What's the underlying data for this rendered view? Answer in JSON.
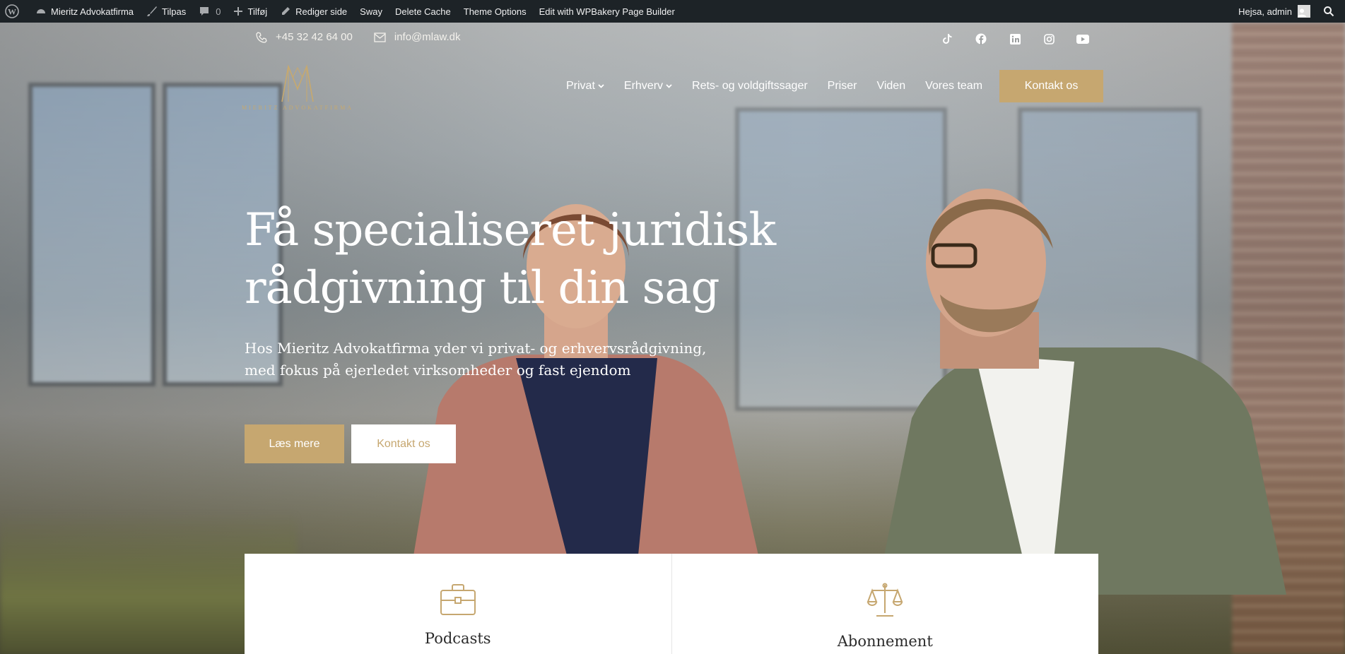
{
  "adminbar": {
    "site_name": "Mieritz Advokatfirma",
    "customize": "Tilpas",
    "comments_count": "0",
    "new": "Tilføj",
    "edit_page": "Rediger side",
    "sway": "Sway",
    "delete_cache": "Delete Cache",
    "theme_options": "Theme Options",
    "wpbakery": "Edit with WPBakery Page Builder",
    "greeting": "Hejsa, admin"
  },
  "contact": {
    "phone": "+45 32 42 64 00",
    "email": "info@mlaw.dk"
  },
  "social": [
    "tiktok-icon",
    "facebook-icon",
    "linkedin-icon",
    "instagram-icon",
    "youtube-icon"
  ],
  "logo": {
    "monogram": "M",
    "text": "MIERITZ ADVOKATFIRMA"
  },
  "nav": {
    "items": [
      {
        "label": "Privat",
        "dropdown": true
      },
      {
        "label": "Erhverv",
        "dropdown": true
      },
      {
        "label": "Rets- og voldgiftssager",
        "dropdown": false
      },
      {
        "label": "Priser",
        "dropdown": false
      },
      {
        "label": "Viden",
        "dropdown": false
      },
      {
        "label": "Vores team",
        "dropdown": false
      }
    ],
    "cta": "Kontakt os"
  },
  "hero": {
    "headline_line1": "Få specialiseret juridisk",
    "headline_line2": "rådgivning til din sag",
    "sub_line1": "Hos Mieritz Advokatfirma yder vi privat- og erhvervsrådgivning,",
    "sub_line2": "med fokus på ejerledet virksomheder og fast ejendom",
    "btn_primary": "Læs mere",
    "btn_secondary": "Kontakt os"
  },
  "cards": [
    {
      "title": "Podcasts",
      "icon": "briefcase-icon"
    },
    {
      "title": "Abonnement",
      "icon": "scales-icon"
    }
  ],
  "colors": {
    "accent": "#c6a770",
    "adminbar": "#1d2327"
  }
}
